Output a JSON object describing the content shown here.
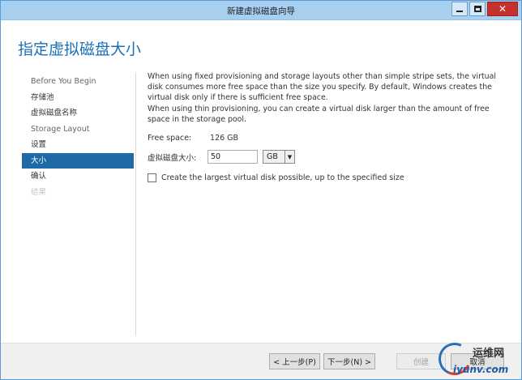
{
  "window": {
    "title": "新建虚拟磁盘向导"
  },
  "page": {
    "heading": "指定虚拟磁盘大小"
  },
  "nav": {
    "items": [
      {
        "label": "Before You Begin",
        "state": "muted"
      },
      {
        "label": "存储池",
        "state": "normal"
      },
      {
        "label": "虚拟磁盘名称",
        "state": "normal"
      },
      {
        "label": "Storage Layout",
        "state": "muted"
      },
      {
        "label": "设置",
        "state": "normal"
      },
      {
        "label": "大小",
        "state": "selected"
      },
      {
        "label": "确认",
        "state": "normal"
      },
      {
        "label": "结果",
        "state": "disabled"
      }
    ]
  },
  "content": {
    "description_lines": [
      "When using fixed provisioning and storage layouts other than simple stripe sets, the virtual",
      "disk consumes more free space than the size you specify. By default, Windows creates the",
      "virtual disk only if there is sufficient free space.",
      "When using thin provisioning, you can create a virtual disk larger than the amount of free",
      "space in the storage pool."
    ],
    "free_space_label": "Free space:",
    "free_space_value": "126 GB",
    "size_label": "虚拟磁盘大小:",
    "size_value": "50",
    "unit_value": "GB",
    "largest_checkbox_label": "Create the largest virtual disk possible, up to the specified size",
    "largest_checked": false
  },
  "footer": {
    "prev_label": "< 上一步(P)",
    "next_label": "下一步(N) >",
    "create_label": "创建",
    "cancel_label": "取消"
  },
  "watermark": {
    "text": "运维网",
    "url": "iyunv.com"
  },
  "colors": {
    "accent": "#1b6fb8",
    "selected_nav": "#1d6aa6",
    "titlebar": "#a7d0f0",
    "close_button": "#c7312c"
  }
}
